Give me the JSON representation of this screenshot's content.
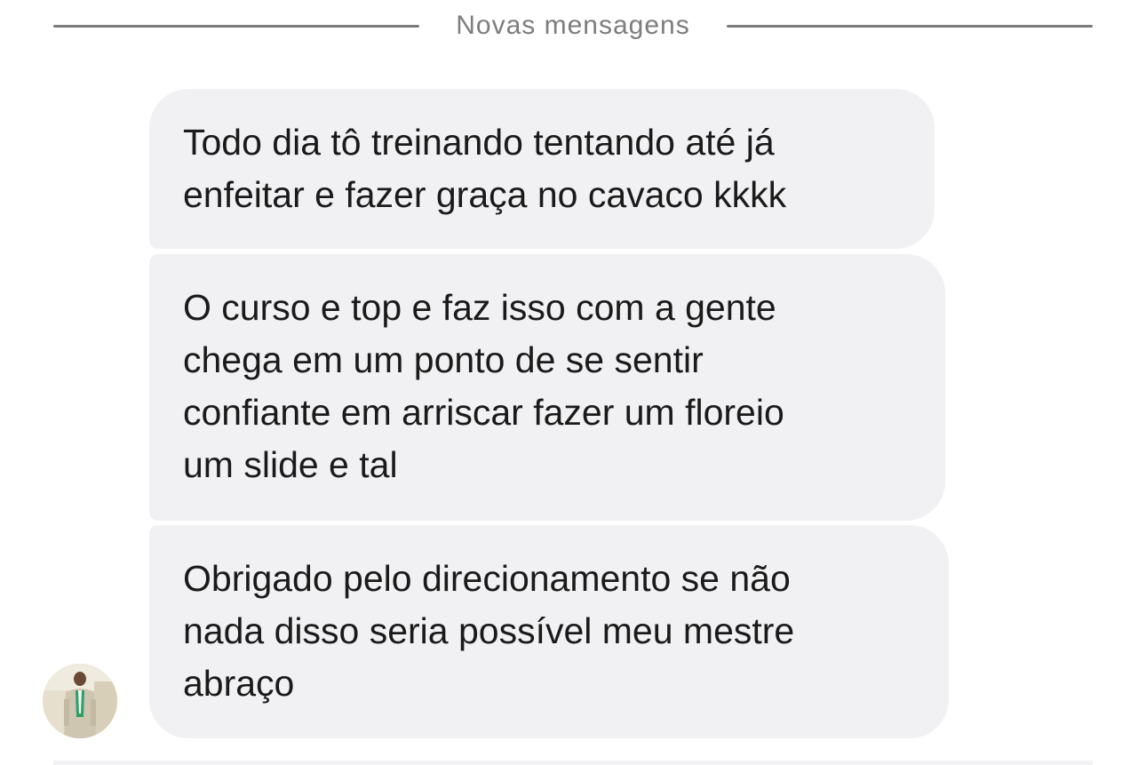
{
  "divider": {
    "label": "Novas mensagens"
  },
  "messages": [
    {
      "text": "Todo dia tô treinando tentando até já\nenfeitar e fazer graça no cavaco kkkk"
    },
    {
      "text": "O curso e top e faz isso com a gente\nchega em um ponto de se sentir\nconfiante em arriscar fazer um floreio\num slide e tal"
    },
    {
      "text": "Obrigado pelo direcionamento se não\nnada disso seria possível meu mestre\nabraço"
    }
  ],
  "sender": {
    "avatar_icon": "person-photo-avatar"
  },
  "colors": {
    "bubble_bg": "#f1f1f3",
    "divider_text": "#7d7d7d",
    "divider_line": "#7a7a7a",
    "message_text": "#1a1a1a"
  }
}
